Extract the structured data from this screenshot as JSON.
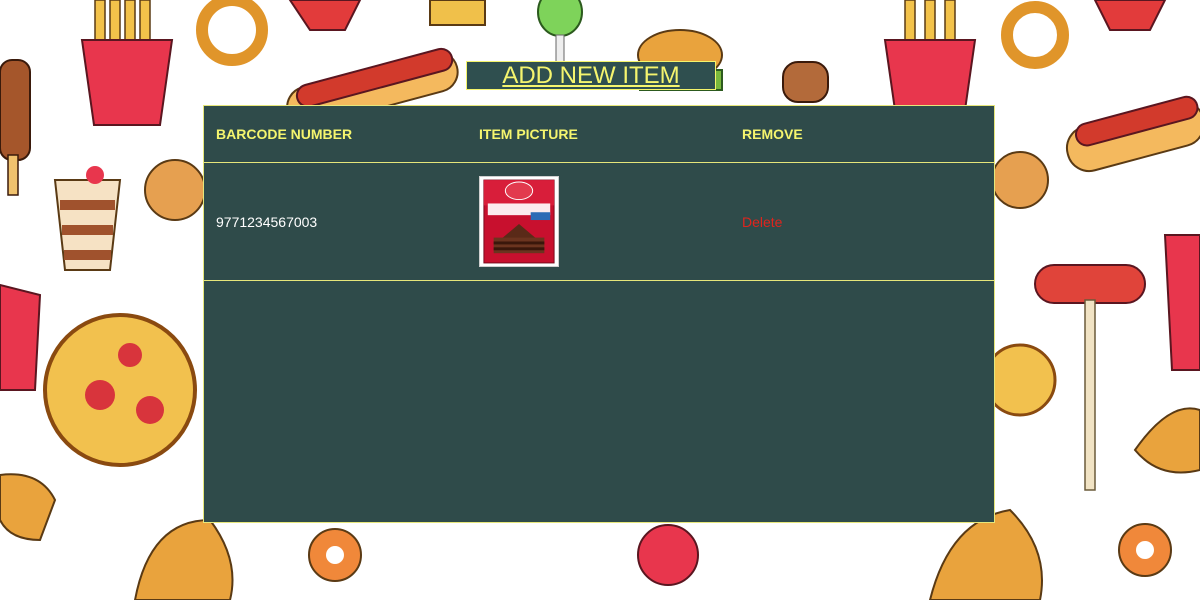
{
  "header": {
    "add_new_item_label": "ADD NEW ITEM"
  },
  "table": {
    "columns": {
      "barcode": "BARCODE NUMBER",
      "picture": "ITEM PICTURE",
      "remove": "REMOVE"
    },
    "rows": [
      {
        "barcode": "9771234567003",
        "picture": {
          "brand": "Betty Crocker",
          "product": "SuperMoist",
          "icon": "cake-mix-box"
        },
        "remove_label": "Delete"
      }
    ]
  },
  "colors": {
    "panel_bg": "#2f4b4a",
    "accent_yellow": "#f5f56e",
    "delete_red": "#e0241d"
  }
}
